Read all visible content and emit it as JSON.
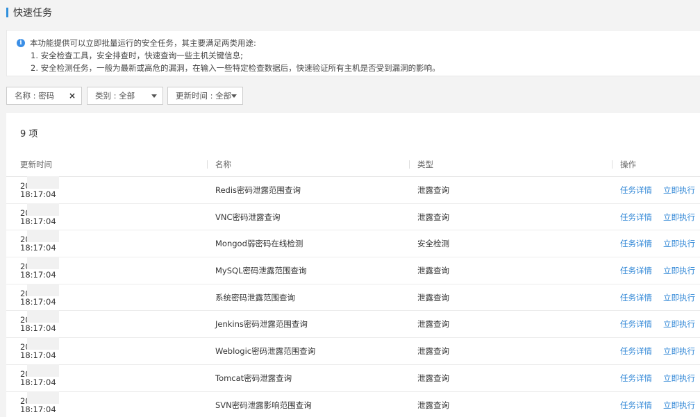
{
  "header": {
    "title": "快速任务"
  },
  "notice": {
    "icon": "info-icon",
    "intro": "本功能提供可以立即批量运行的安全任务，其主要满足两类用途:",
    "lines": [
      "1. 安全检查工具，安全排查时，快速查询一些主机关键信息;",
      "2. 安全检测任务，一般为最新或高危的漏洞，在输入一些特定检查数据后，快速验证所有主机是否受到漏洞的影响。"
    ]
  },
  "filters": {
    "name": {
      "label": "名称 : 密码",
      "clear_icon": "close-icon"
    },
    "category": {
      "label": "类别 : 全部",
      "icon": "caret-down-icon"
    },
    "update_time": {
      "label": "更新时间 : 全部",
      "icon": "caret-down-icon"
    }
  },
  "table": {
    "count": "9 项",
    "headers": {
      "time": "更新时间",
      "name": "名称",
      "type": "类型",
      "action": "操作"
    },
    "rows": [
      {
        "date": "20",
        "time": "18:17:04",
        "name": "Redis密码泄露范围查询",
        "type": "泄露查询",
        "detail": "任务详情",
        "run": "立即执行"
      },
      {
        "date": "20",
        "time": "18:17:04",
        "name": "VNC密码泄露查询",
        "type": "泄露查询",
        "detail": "任务详情",
        "run": "立即执行"
      },
      {
        "date": "20",
        "time": "18:17:04",
        "name": "Mongod弱密码在线检测",
        "type": "安全检测",
        "detail": "任务详情",
        "run": "立即执行"
      },
      {
        "date": "20",
        "time": "18:17:04",
        "name": "MySQL密码泄露范围查询",
        "type": "泄露查询",
        "detail": "任务详情",
        "run": "立即执行"
      },
      {
        "date": "20",
        "time": "18:17:04",
        "name": "系统密码泄露范围查询",
        "type": "泄露查询",
        "detail": "任务详情",
        "run": "立即执行"
      },
      {
        "date": "20",
        "time": "18:17:04",
        "name": "Jenkins密码泄露范围查询",
        "type": "泄露查询",
        "detail": "任务详情",
        "run": "立即执行"
      },
      {
        "date": "20",
        "time": "18:17:04",
        "name": "Weblogic密码泄露范围查询",
        "type": "泄露查询",
        "detail": "任务详情",
        "run": "立即执行"
      },
      {
        "date": "20",
        "time": "18:17:04",
        "name": "Tomcat密码泄露查询",
        "type": "泄露查询",
        "detail": "任务详情",
        "run": "立即执行"
      },
      {
        "date": "20",
        "time": "18:17:04",
        "name": "SVN密码泄露影响范围查询",
        "type": "泄露查询",
        "detail": "任务详情",
        "run": "立即执行"
      }
    ]
  },
  "colors": {
    "accent": "#2f8fdc",
    "link": "#2f86d6",
    "info": "#3a8ee6"
  }
}
